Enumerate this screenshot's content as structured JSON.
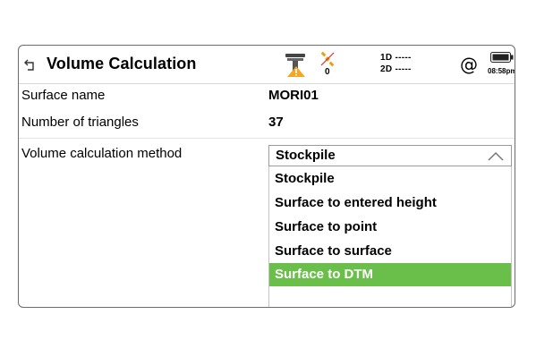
{
  "header": {
    "title": "Volume Calculation",
    "satellites": "0",
    "precision_1d": "1D -----",
    "precision_2d": "2D -----",
    "at_symbol": "@",
    "time": "08:58pm",
    "icons": [
      "back-icon",
      "gnss-receiver-warning-icon",
      "satellite-icon",
      "at-icon",
      "battery-icon"
    ]
  },
  "fields": {
    "surface_name_label": "Surface name",
    "surface_name_value": "MORI01",
    "triangles_label": "Number of triangles",
    "triangles_value": "37",
    "method_label": "Volume calculation method",
    "method_value": "Stockpile"
  },
  "dropdown": {
    "options": [
      "Stockpile",
      "Surface to entered height",
      "Surface to point",
      "Surface to surface",
      "Surface to DTM"
    ],
    "highlighted": "Surface to DTM"
  },
  "colors": {
    "highlight": "#6abf4b",
    "warning": "#f5a623",
    "satellite": "#f39c12"
  }
}
